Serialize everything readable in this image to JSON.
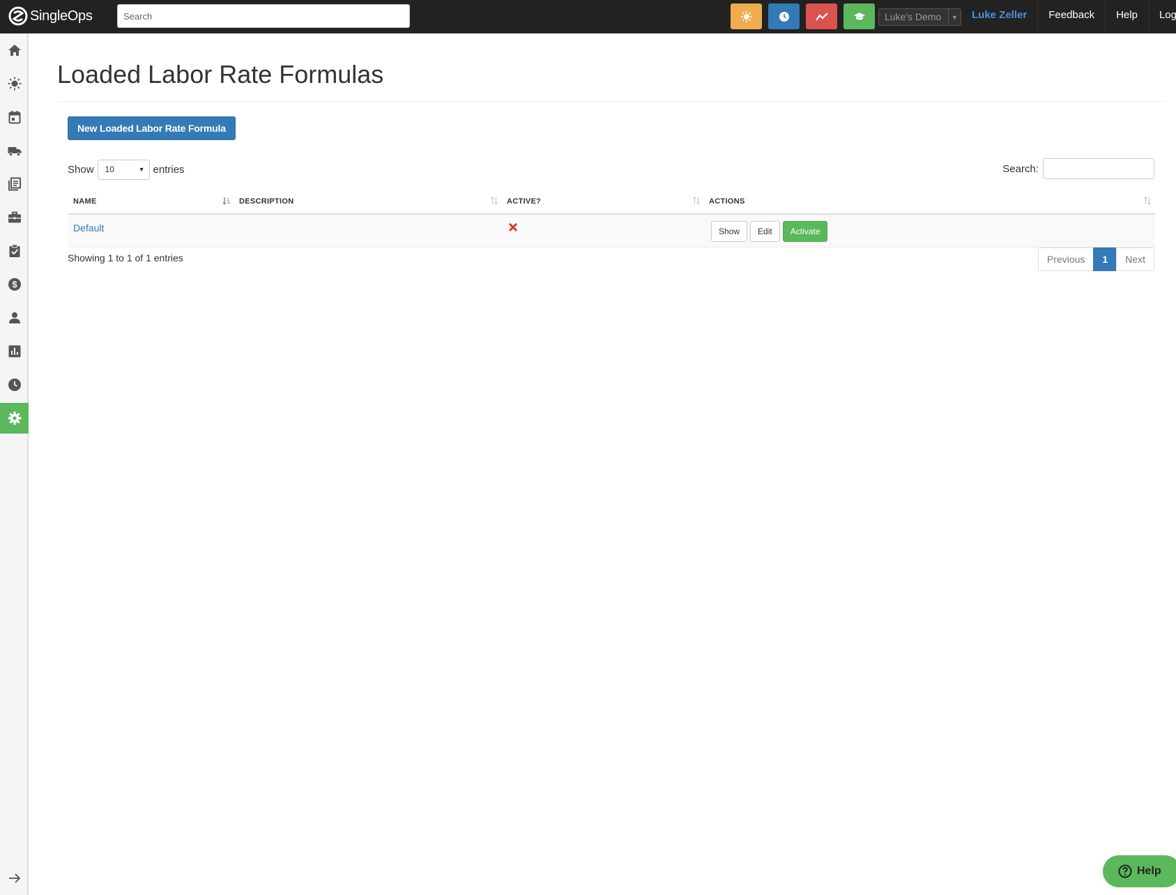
{
  "app": {
    "logo_text": "SingleOps"
  },
  "topbar": {
    "search_placeholder": "Search",
    "company": "Luke's Demo",
    "nav": [
      {
        "label": "Luke Zeller"
      },
      {
        "label": "Feedback"
      },
      {
        "label": "Help"
      },
      {
        "label": "Logout"
      }
    ],
    "quick_buttons": [
      {
        "icon": "sun-icon",
        "color": "#f0ad4e"
      },
      {
        "icon": "clock-icon",
        "color": "#337ab7"
      },
      {
        "icon": "trend-line-icon",
        "color": "#d9534f"
      },
      {
        "icon": "graduation-cap-icon",
        "color": "#5cb85c"
      }
    ]
  },
  "sidebar": {
    "items": [
      {
        "icon": "home-icon"
      },
      {
        "icon": "sun-icon"
      },
      {
        "icon": "calendar-icon"
      },
      {
        "icon": "truck-icon"
      },
      {
        "icon": "documents-icon"
      },
      {
        "icon": "briefcase-icon"
      },
      {
        "icon": "clipboard-check-icon"
      },
      {
        "icon": "dollar-icon"
      },
      {
        "icon": "person-icon"
      },
      {
        "icon": "bar-chart-icon"
      },
      {
        "icon": "clock-icon"
      },
      {
        "icon": "gear-icon",
        "active": true
      }
    ],
    "collapse_icon": "arrow-right-icon",
    "active_color": "#5cb85c"
  },
  "page": {
    "title": "Loaded Labor Rate Formulas",
    "new_button": "New Loaded Labor Rate Formula"
  },
  "table_controls": {
    "show_label": "Show",
    "page_length": "10",
    "entries_label": "entries",
    "search_label": "Search:",
    "search_value": ""
  },
  "table": {
    "columns": [
      "NAME",
      "DESCRIPTION",
      "ACTIVE?",
      "ACTIONS"
    ],
    "rows": [
      {
        "name": "Default",
        "description": "",
        "active": false,
        "active_icon": "red-x-icon",
        "actions": [
          "Show",
          "Edit",
          "Activate"
        ]
      }
    ]
  },
  "table_footer": {
    "info": "Showing 1 to 1 of 1 entries",
    "pagination": {
      "previous": "Previous",
      "current": "1",
      "next": "Next"
    }
  },
  "help_widget": {
    "label": "Help"
  }
}
